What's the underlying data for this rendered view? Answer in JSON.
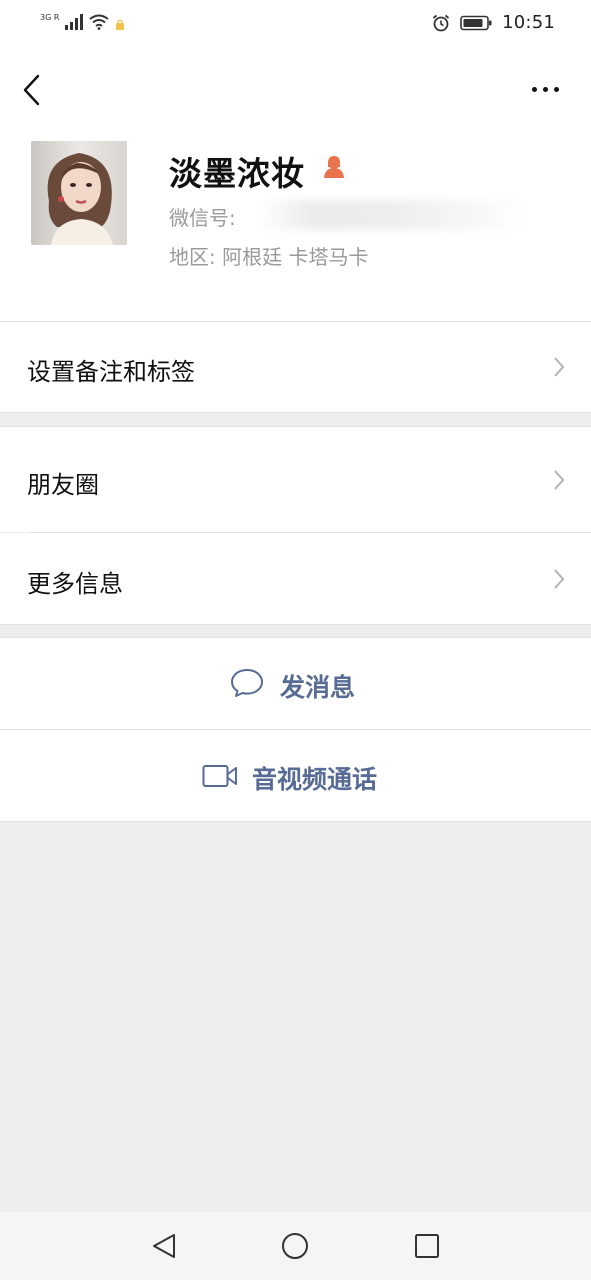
{
  "status_bar": {
    "network_label": "3G R",
    "time": "10:51"
  },
  "header": {
    "back_icon": "chevron-left-icon",
    "more_icon": "more-dots-icon"
  },
  "profile": {
    "name": "淡墨浓妆",
    "gender_icon": "female-icon",
    "wechat_id_label": "微信号: ",
    "region_label": "地区: 阿根廷  卡塔马卡",
    "accent_color": "#e8734c"
  },
  "menu": {
    "remark_tags": "设置备注和标签",
    "moments": "朋友圈",
    "more_info": "更多信息"
  },
  "actions": {
    "send_message": "发消息",
    "video_call": "音视频通话",
    "link_color": "#576b95"
  },
  "nav_bar": {
    "back": "triangle-back-icon",
    "home": "circle-home-icon",
    "recents": "square-recents-icon"
  }
}
